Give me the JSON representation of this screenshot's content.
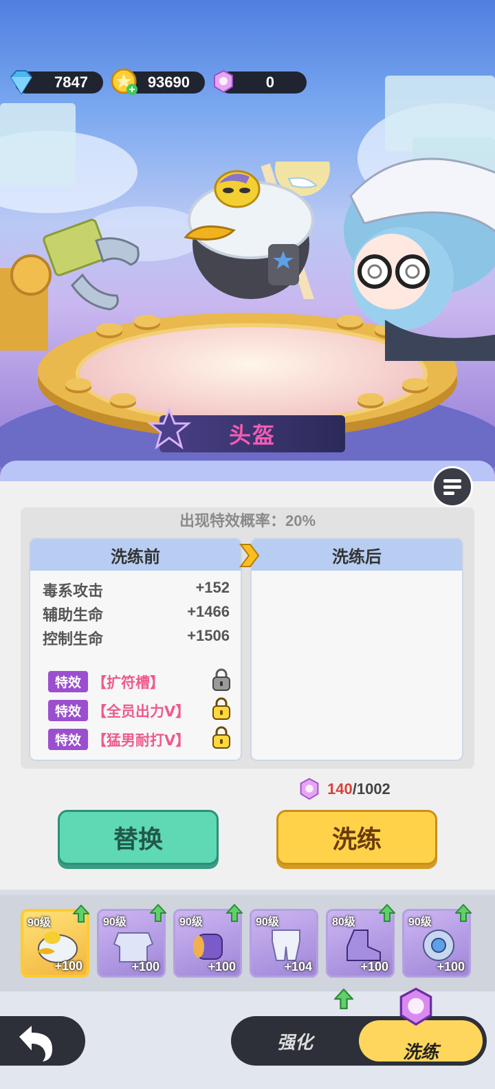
{
  "currency": {
    "diamond": "7847",
    "gold": "93690",
    "refine_stone": "0"
  },
  "equipment_title": "头盔",
  "effect_probability": "出现特效概率：20%",
  "before": {
    "header": "洗练前",
    "stats": [
      {
        "name": "毒系攻击",
        "value": "+152"
      },
      {
        "name": "辅助生命",
        "value": "+1466"
      },
      {
        "name": "控制生命",
        "value": "+1506"
      }
    ],
    "effects": [
      {
        "badge": "特效",
        "name": "【扩符槽】",
        "lock": "gray"
      },
      {
        "badge": "特效",
        "name": "【全员出力Ⅴ】",
        "lock": "gold"
      },
      {
        "badge": "特效",
        "name": "【猛男耐打Ⅴ】",
        "lock": "gold"
      }
    ]
  },
  "after": {
    "header": "洗练后"
  },
  "cost": {
    "current": "140",
    "separator": "/",
    "total": "1002"
  },
  "buttons": {
    "replace": "替换",
    "refine": "洗练"
  },
  "equipment_slots": [
    {
      "level": "90级",
      "bonus": "+100",
      "item": "helmet-icon",
      "selected": true
    },
    {
      "level": "90级",
      "bonus": "+100",
      "item": "armor-icon",
      "selected": false
    },
    {
      "level": "90级",
      "bonus": "+100",
      "item": "bracer-icon",
      "selected": false
    },
    {
      "level": "90级",
      "bonus": "+104",
      "item": "pants-icon",
      "selected": false
    },
    {
      "level": "80级",
      "bonus": "+100",
      "item": "boots-icon",
      "selected": false
    },
    {
      "level": "90级",
      "bonus": "+100",
      "item": "accessory-icon",
      "selected": false
    }
  ],
  "tabs": {
    "enhance": "强化",
    "refine": "洗练"
  },
  "colors": {
    "accent_gold": "#ffd24a",
    "accent_green": "#5fd9b4",
    "effect_purple": "#9b4fcf",
    "effect_pink": "#ee5a8e",
    "cost_red": "#d9423b"
  }
}
